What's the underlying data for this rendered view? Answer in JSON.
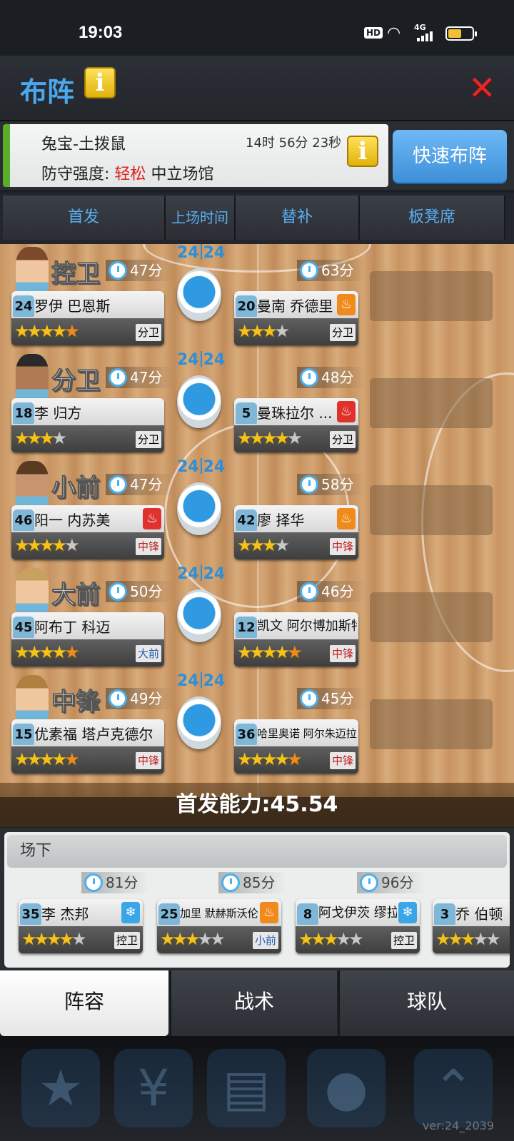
{
  "status": {
    "time": "19:03",
    "hd": "HD",
    "network": "4G",
    "battery_level": 0.55
  },
  "header": {
    "title": "布阵",
    "info_icon": "info-icon",
    "close_icon": "close-icon"
  },
  "match": {
    "opponent": "兔宝-土拨鼠",
    "countdown": "14时 56分 23秒",
    "defense_label": "防守强度:",
    "difficulty": "轻松",
    "venue": "中立场馆",
    "quick_button": "快速布阵"
  },
  "tabs": [
    "首发",
    "上场时间",
    "替补",
    "板凳席"
  ],
  "rows": [
    {
      "position": "控卫",
      "score_left": "24",
      "score_right": "24",
      "starter": {
        "minutes": "47分",
        "number": "24",
        "name": "罗伊 巴恩斯",
        "stars": "4.5",
        "role": "分卫",
        "state": ""
      },
      "sub": {
        "minutes": "63分",
        "number": "20",
        "name": "曼南 乔德里",
        "stars": "4",
        "role": "分卫",
        "state": "fire"
      }
    },
    {
      "position": "分卫",
      "score_left": "24",
      "score_right": "24",
      "starter": {
        "minutes": "47分",
        "number": "18",
        "name": "李 归方",
        "stars": "3",
        "role": "分卫",
        "state": ""
      },
      "sub": {
        "minutes": "48分",
        "number": "5",
        "name": "曼珠拉尔 ...",
        "stars": "4",
        "role": "分卫",
        "state": "hot"
      }
    },
    {
      "position": "小前",
      "score_left": "24",
      "score_right": "24",
      "starter": {
        "minutes": "47分",
        "number": "46",
        "name": "阳一 内苏美",
        "stars": "4",
        "role": "中锋",
        "state": "hot"
      },
      "sub": {
        "minutes": "58分",
        "number": "42",
        "name": "廖 择华",
        "stars": "4",
        "role": "中锋",
        "state": "fire"
      }
    },
    {
      "position": "大前",
      "score_left": "24",
      "score_right": "24",
      "starter": {
        "minutes": "50分",
        "number": "45",
        "name": "阿布丁 科迈",
        "stars": "5",
        "role": "大前",
        "state": ""
      },
      "sub": {
        "minutes": "46分",
        "number": "12",
        "name": "凯文 阿尔博加斯特",
        "stars": "4.5",
        "role": "中锋",
        "state": ""
      }
    },
    {
      "position": "中锋",
      "score_left": "24",
      "score_right": "24",
      "starter": {
        "minutes": "49分",
        "number": "15",
        "name": "优素福 塔卢克德尔",
        "stars": "4.5",
        "role": "中锋",
        "state": ""
      },
      "sub": {
        "minutes": "45分",
        "number": "36",
        "name": "哈里奥诺 阿尔朱迈拉伊",
        "stars": "5",
        "role": "中锋",
        "state": ""
      }
    }
  ],
  "power": "首发能力:45.54",
  "bench": {
    "title": "场下",
    "players": [
      {
        "minutes": "81分",
        "number": "35",
        "name": "李 杰邦",
        "role": "控卫",
        "state": "cold"
      },
      {
        "minutes": "85分",
        "number": "25",
        "name": "加里 默赫斯沃伦",
        "role": "小前",
        "state": "fire"
      },
      {
        "minutes": "96分",
        "number": "8",
        "name": "阿戈伊茨 缪拉",
        "role": "控卫",
        "state": "cold"
      },
      {
        "minutes": "",
        "number": "3",
        "name": "乔 伯顿",
        "role": "",
        "state": ""
      }
    ]
  },
  "bottom_tabs": [
    "阵容",
    "战术",
    "球队"
  ],
  "version": "ver:24_2039"
}
